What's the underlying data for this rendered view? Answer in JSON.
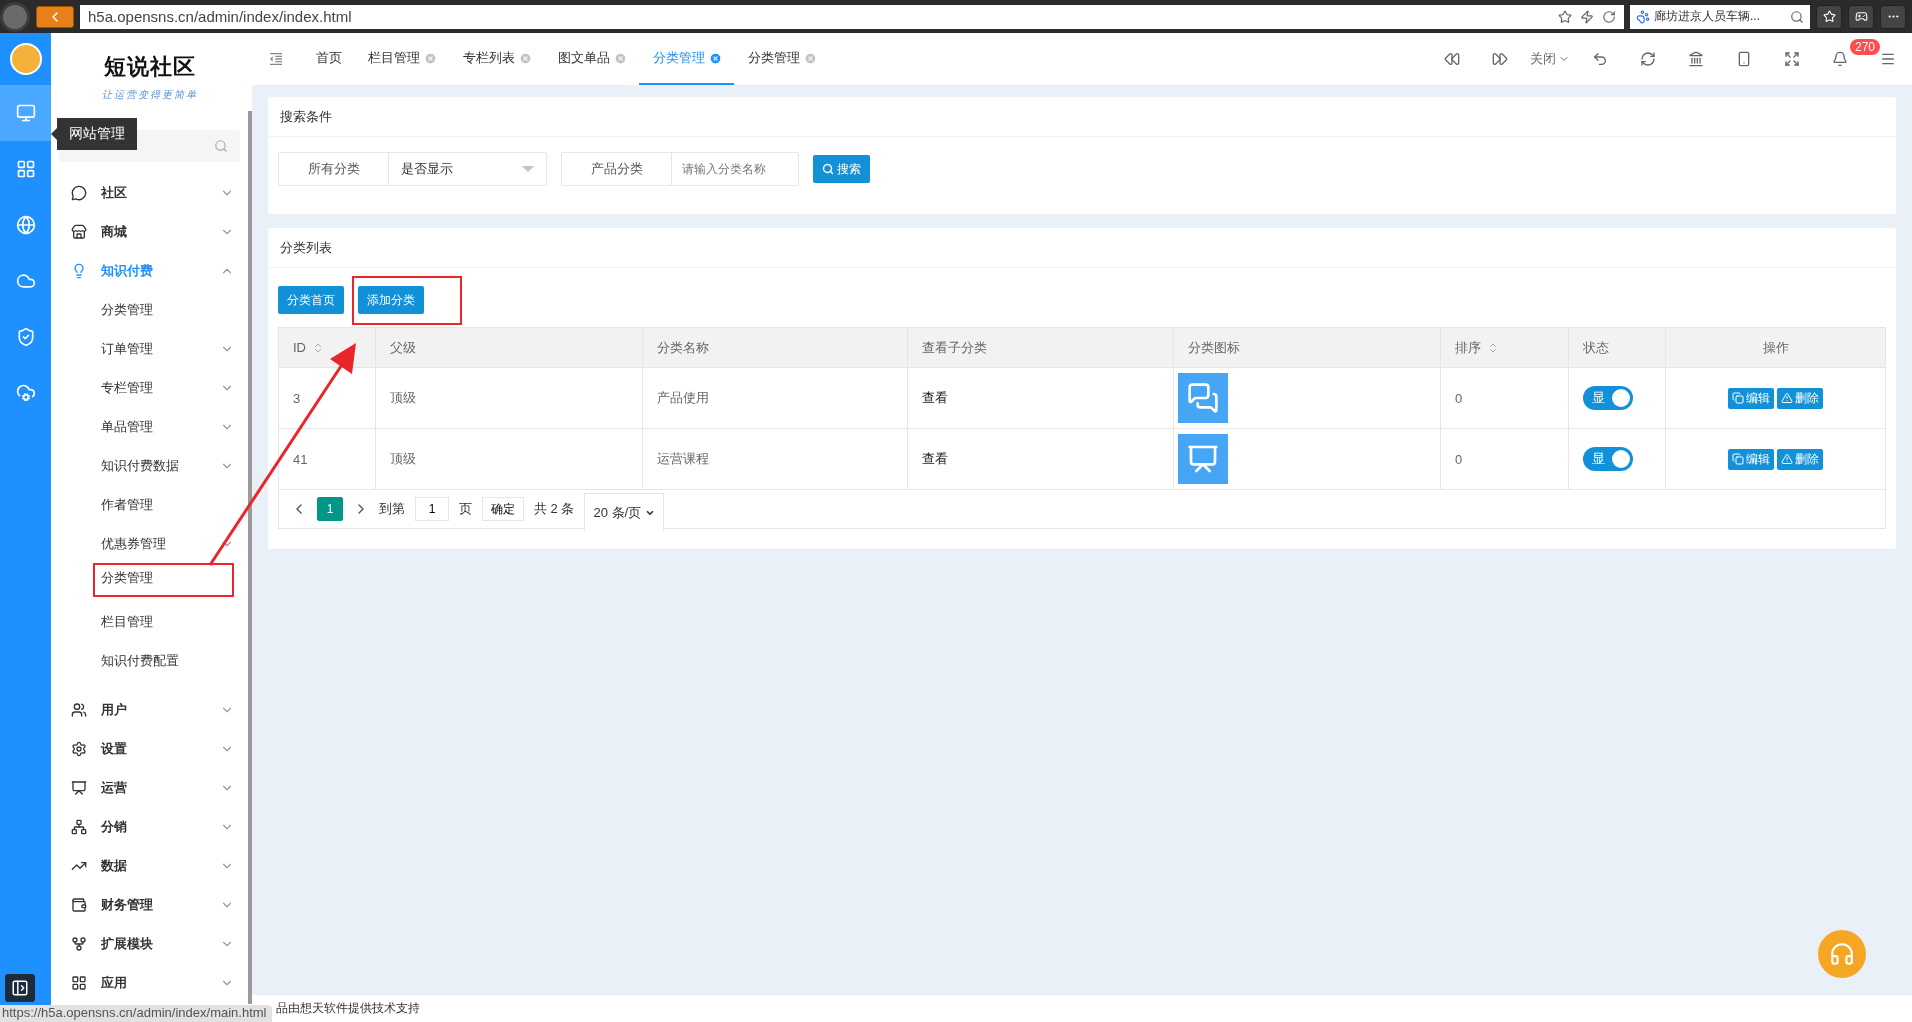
{
  "browser": {
    "url": "h5a.opensns.cn/admin/index/index.html",
    "search": "廊坊进京人员车辆...",
    "status_url": "https://h5a.opensns.cn/admin/index/main.html"
  },
  "logo": {
    "title": "短说社区",
    "slogan": "让运营变得更简单"
  },
  "rail": {
    "tooltip": "网站管理",
    "items": [
      {
        "selected": true
      },
      {
        "selected": false
      },
      {
        "selected": false
      },
      {
        "selected": false
      },
      {
        "selected": false
      },
      {
        "selected": false
      }
    ]
  },
  "tabs": [
    {
      "label": "首页",
      "closable": false,
      "selected": false
    },
    {
      "label": "栏目管理",
      "closable": true,
      "selected": false
    },
    {
      "label": "专栏列表",
      "closable": true,
      "selected": false
    },
    {
      "label": "图文单品",
      "closable": true,
      "selected": false
    },
    {
      "label": "分类管理",
      "closable": true,
      "selected": true
    },
    {
      "label": "分类管理",
      "closable": true,
      "selected": false
    }
  ],
  "toolbar": {
    "close_label": "关闭",
    "notifications": "270"
  },
  "sidebar": {
    "items": [
      {
        "label": "社区",
        "expanded": false,
        "selected": false
      },
      {
        "label": "商城",
        "expanded": false,
        "selected": false
      },
      {
        "label": "知识付费",
        "expanded": true,
        "selected": true,
        "children": [
          {
            "label": "分类管理",
            "expandable": false,
            "annotated": false
          },
          {
            "label": "订单管理",
            "expandable": true,
            "annotated": false
          },
          {
            "label": "专栏管理",
            "expandable": true,
            "annotated": false
          },
          {
            "label": "单品管理",
            "expandable": true,
            "annotated": false
          },
          {
            "label": "知识付费数据",
            "expandable": true,
            "annotated": false
          },
          {
            "label": "作者管理",
            "expandable": false,
            "annotated": false
          },
          {
            "label": "优惠券管理",
            "expandable": true,
            "annotated": false
          },
          {
            "label": "分类管理",
            "expandable": false,
            "annotated": true
          },
          {
            "label": "栏目管理",
            "expandable": false,
            "annotated": false
          },
          {
            "label": "知识付费配置",
            "expandable": false,
            "annotated": false
          }
        ]
      },
      {
        "label": "用户",
        "expanded": false,
        "selected": false
      },
      {
        "label": "设置",
        "expanded": false,
        "selected": false
      },
      {
        "label": "运营",
        "expanded": false,
        "selected": false
      },
      {
        "label": "分销",
        "expanded": false,
        "selected": false
      },
      {
        "label": "数据",
        "expanded": false,
        "selected": false
      },
      {
        "label": "财务管理",
        "expanded": false,
        "selected": false
      },
      {
        "label": "扩展模块",
        "expanded": false,
        "selected": false
      },
      {
        "label": "应用",
        "expanded": false,
        "selected": false
      }
    ]
  },
  "search": {
    "title": "搜索条件",
    "filter_label": "所有分类",
    "filter_value": "是否显示",
    "name_label": "产品分类",
    "name_placeholder": "请输入分类名称",
    "button": "搜索"
  },
  "list": {
    "title": "分类列表",
    "buttons": [
      {
        "label": "分类首页",
        "annotated": false
      },
      {
        "label": "添加分类",
        "annotated": true
      }
    ],
    "table": {
      "columns": [
        {
          "label": "ID",
          "sortable": true
        },
        {
          "label": "父级",
          "sortable": false
        },
        {
          "label": "分类名称",
          "sortable": false
        },
        {
          "label": "查看子分类",
          "sortable": false
        },
        {
          "label": "分类图标",
          "sortable": false
        },
        {
          "label": "排序",
          "sortable": true
        },
        {
          "label": "状态",
          "sortable": false
        },
        {
          "label": "操作",
          "sortable": false
        }
      ],
      "rows": [
        {
          "id": "3",
          "parent": "顶级",
          "name": "产品使用",
          "view": "查看",
          "sort": "0",
          "status": {
            "label": "显",
            "on": true
          },
          "actions": [
            "编辑",
            "删除"
          ]
        },
        {
          "id": "41",
          "parent": "顶级",
          "name": "运营课程",
          "view": "查看",
          "sort": "0",
          "status": {
            "label": "显",
            "on": true
          },
          "actions": [
            "编辑",
            "删除"
          ]
        }
      ]
    },
    "pager": {
      "pages": [
        {
          "label": "1",
          "selected": true
        }
      ],
      "goto": "到第",
      "page_value": "1",
      "page_unit": "页",
      "confirm": "确定",
      "total": "共 2 条",
      "per_page": "20 条/页"
    }
  },
  "footer": "品由想天软件提供技术支持",
  "annotation_arrow": true
}
